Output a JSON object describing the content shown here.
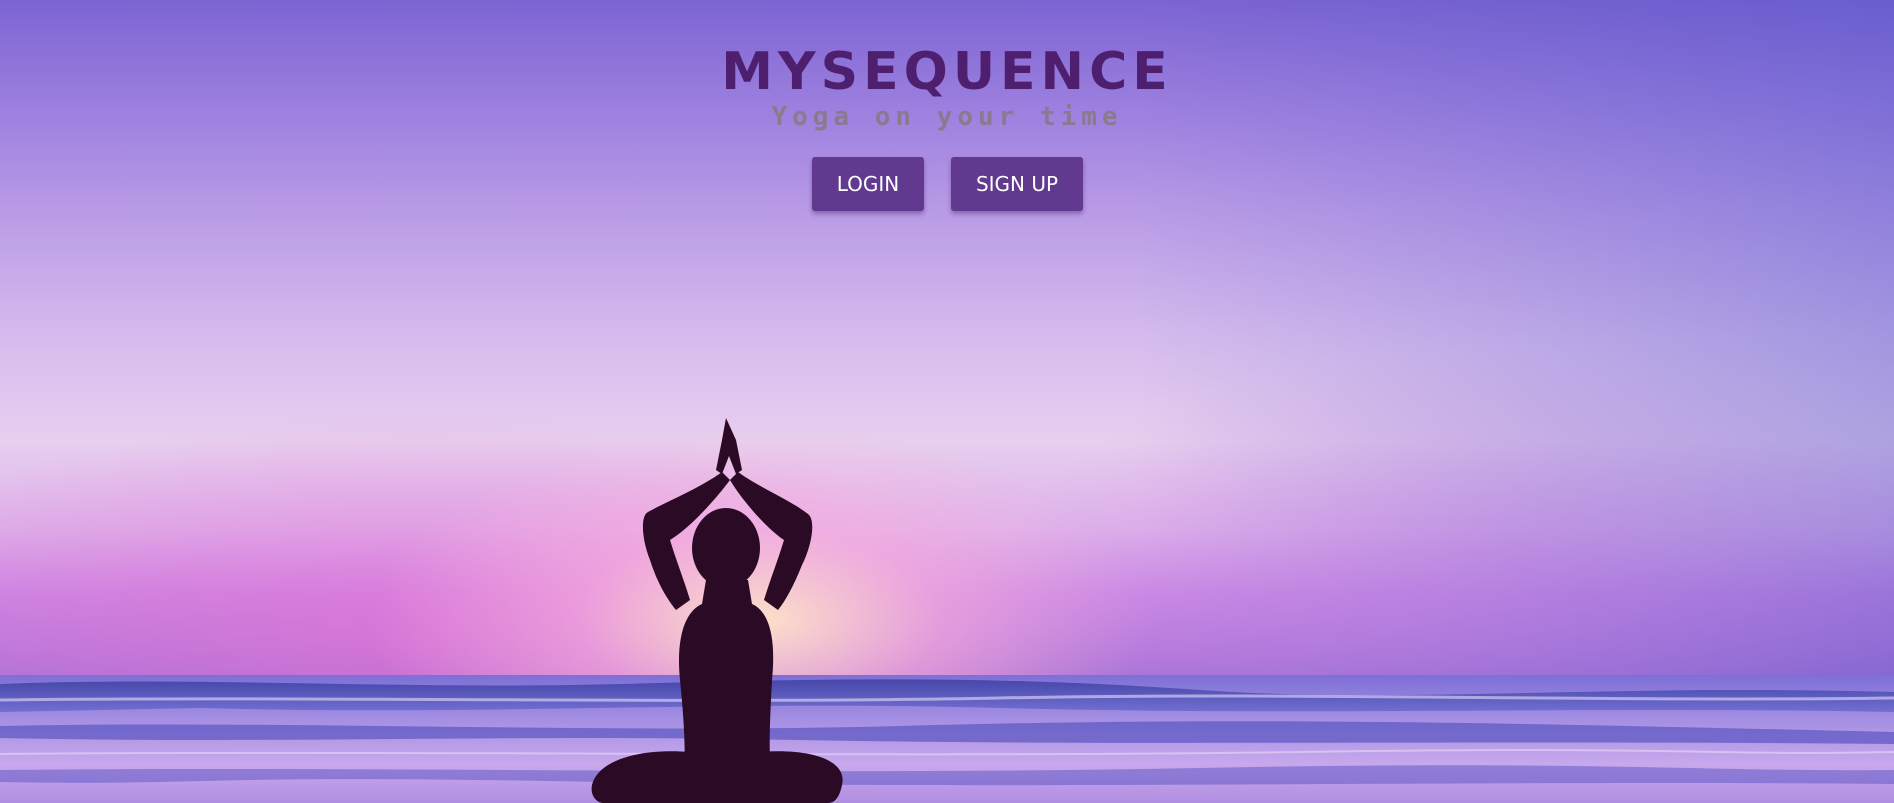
{
  "brand": {
    "logo_text": "MYSEQUENCE",
    "tagline": "Yoga on your time"
  },
  "actions": {
    "login_label": "LOGIN",
    "signup_label": "SIGN UP"
  },
  "colors": {
    "button_bg": "#61398f",
    "logo_color": "#4f1f6f",
    "tagline_color": "#8a7a8e"
  }
}
